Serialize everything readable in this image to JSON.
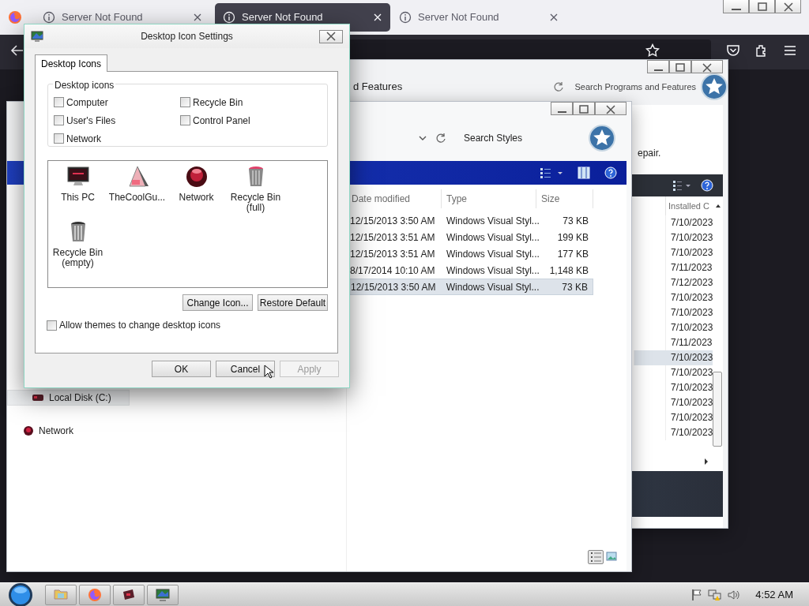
{
  "browser": {
    "tabs": [
      {
        "label": "Server Not Found",
        "selected": false
      },
      {
        "label": "Server Not Found",
        "selected": true
      },
      {
        "label": "Server Not Found",
        "selected": false
      }
    ]
  },
  "programs_window": {
    "address": "d Features",
    "search_placeholder": "Search Programs and Features",
    "description": "epair.",
    "column": "Installed C",
    "rows": [
      {
        "installed": "7/10/2023",
        "selected": false
      },
      {
        "installed": "7/10/2023",
        "selected": false
      },
      {
        "installed": "7/10/2023",
        "selected": false
      },
      {
        "installed": "7/11/2023",
        "selected": false
      },
      {
        "installed": "7/12/2023",
        "selected": false
      },
      {
        "installed": "7/10/2023",
        "selected": false
      },
      {
        "installed": "7/10/2023",
        "selected": false
      },
      {
        "installed": "7/10/2023",
        "selected": false
      },
      {
        "installed": "7/11/2023",
        "selected": false
      },
      {
        "installed": "7/10/2023",
        "selected": true
      },
      {
        "installed": "7/10/2023",
        "selected": false
      },
      {
        "installed": "7/10/2023",
        "selected": false
      },
      {
        "installed": "7/10/2023",
        "selected": false
      },
      {
        "installed": "7/10/2023",
        "selected": false
      },
      {
        "installed": "7/10/2023",
        "selected": false
      }
    ]
  },
  "styles_window": {
    "search_placeholder": "Search Styles",
    "columns": [
      "Date modified",
      "Type",
      "Size"
    ],
    "rows": [
      {
        "date_modified": "12/15/2013 3:50 AM",
        "type": "Windows Visual Styl...",
        "size": "73 KB",
        "selected": false
      },
      {
        "date_modified": "12/15/2013 3:51 AM",
        "type": "Windows Visual Styl...",
        "size": "199 KB",
        "selected": false
      },
      {
        "date_modified": "12/15/2013 3:51 AM",
        "type": "Windows Visual Styl...",
        "size": "177 KB",
        "selected": false
      },
      {
        "date_modified": "8/17/2014 10:10 AM",
        "type": "Windows Visual Styl...",
        "size": "1,148 KB",
        "selected": false
      },
      {
        "date_modified": "12/15/2013 3:50 AM",
        "type": "Windows Visual Styl...",
        "size": "73 KB",
        "selected": true
      }
    ],
    "nav": [
      {
        "label": "Local Disk (C:)",
        "kind": "drive",
        "selected": true
      },
      {
        "label": "Network",
        "kind": "network",
        "selected": false
      }
    ]
  },
  "dialog": {
    "title": "Desktop Icon Settings",
    "tabs": [
      {
        "label": "Desktop Icons",
        "selected": true
      }
    ],
    "group_label": "Desktop icons",
    "checkboxes": [
      {
        "label": "Computer",
        "checked": false
      },
      {
        "label": "Recycle Bin",
        "checked": false
      },
      {
        "label": "User's Files",
        "checked": false
      },
      {
        "label": "Control Panel",
        "checked": false
      },
      {
        "label": "Network",
        "checked": false
      }
    ],
    "icons": [
      {
        "label": "This PC",
        "kind": "monitor"
      },
      {
        "label": "TheCoolGu...",
        "kind": "cone"
      },
      {
        "label": "Network",
        "kind": "orb"
      },
      {
        "label": "Recycle Bin (full)",
        "kind": "bin_full"
      },
      {
        "label": "Recycle Bin (empty)",
        "kind": "bin_empty"
      }
    ],
    "icon_buttons": [
      "Change Icon...",
      "Restore Default"
    ],
    "allow_themes": {
      "label": "Allow themes to change desktop icons",
      "checked": false
    },
    "buttons": [
      {
        "label": "OK",
        "disabled": false
      },
      {
        "label": "Cancel",
        "disabled": false
      },
      {
        "label": "Apply",
        "disabled": true
      }
    ]
  },
  "taskbar": {
    "clock": "4:52 AM"
  }
}
